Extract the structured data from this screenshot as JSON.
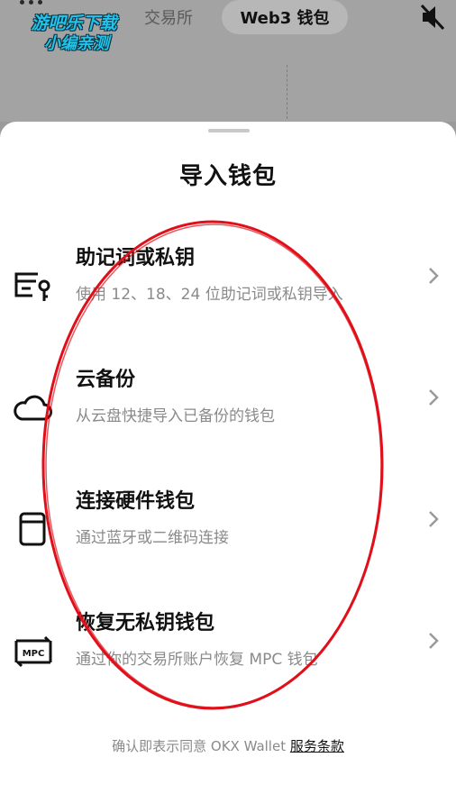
{
  "watermark": {
    "line1": "游吧乐下载",
    "line2": "小编亲测"
  },
  "header": {
    "tab_exchange": "交易所",
    "tab_web3": "Web3 钱包"
  },
  "sheet": {
    "title": "导入钱包",
    "options": [
      {
        "title": "助记词或私钥",
        "desc": "使用 12、18、24 位助记词或私钥导入",
        "icon": "key-card-icon"
      },
      {
        "title": "云备份",
        "desc": "从云盘快捷导入已备份的钱包",
        "icon": "cloud-icon"
      },
      {
        "title": "连接硬件钱包",
        "desc": "通过蓝牙或二维码连接",
        "icon": "hardware-wallet-icon"
      },
      {
        "title": "恢复无私钥钱包",
        "desc": "通过你的交易所账户恢复 MPC 钱包",
        "icon": "mpc-icon",
        "icon_text": "MPC"
      }
    ],
    "footer_text": "确认即表示同意 OKX Wallet ",
    "footer_link": "服务条款"
  },
  "colors": {
    "annotation": "#e0101a",
    "accent_logo": "#23c2e8"
  }
}
